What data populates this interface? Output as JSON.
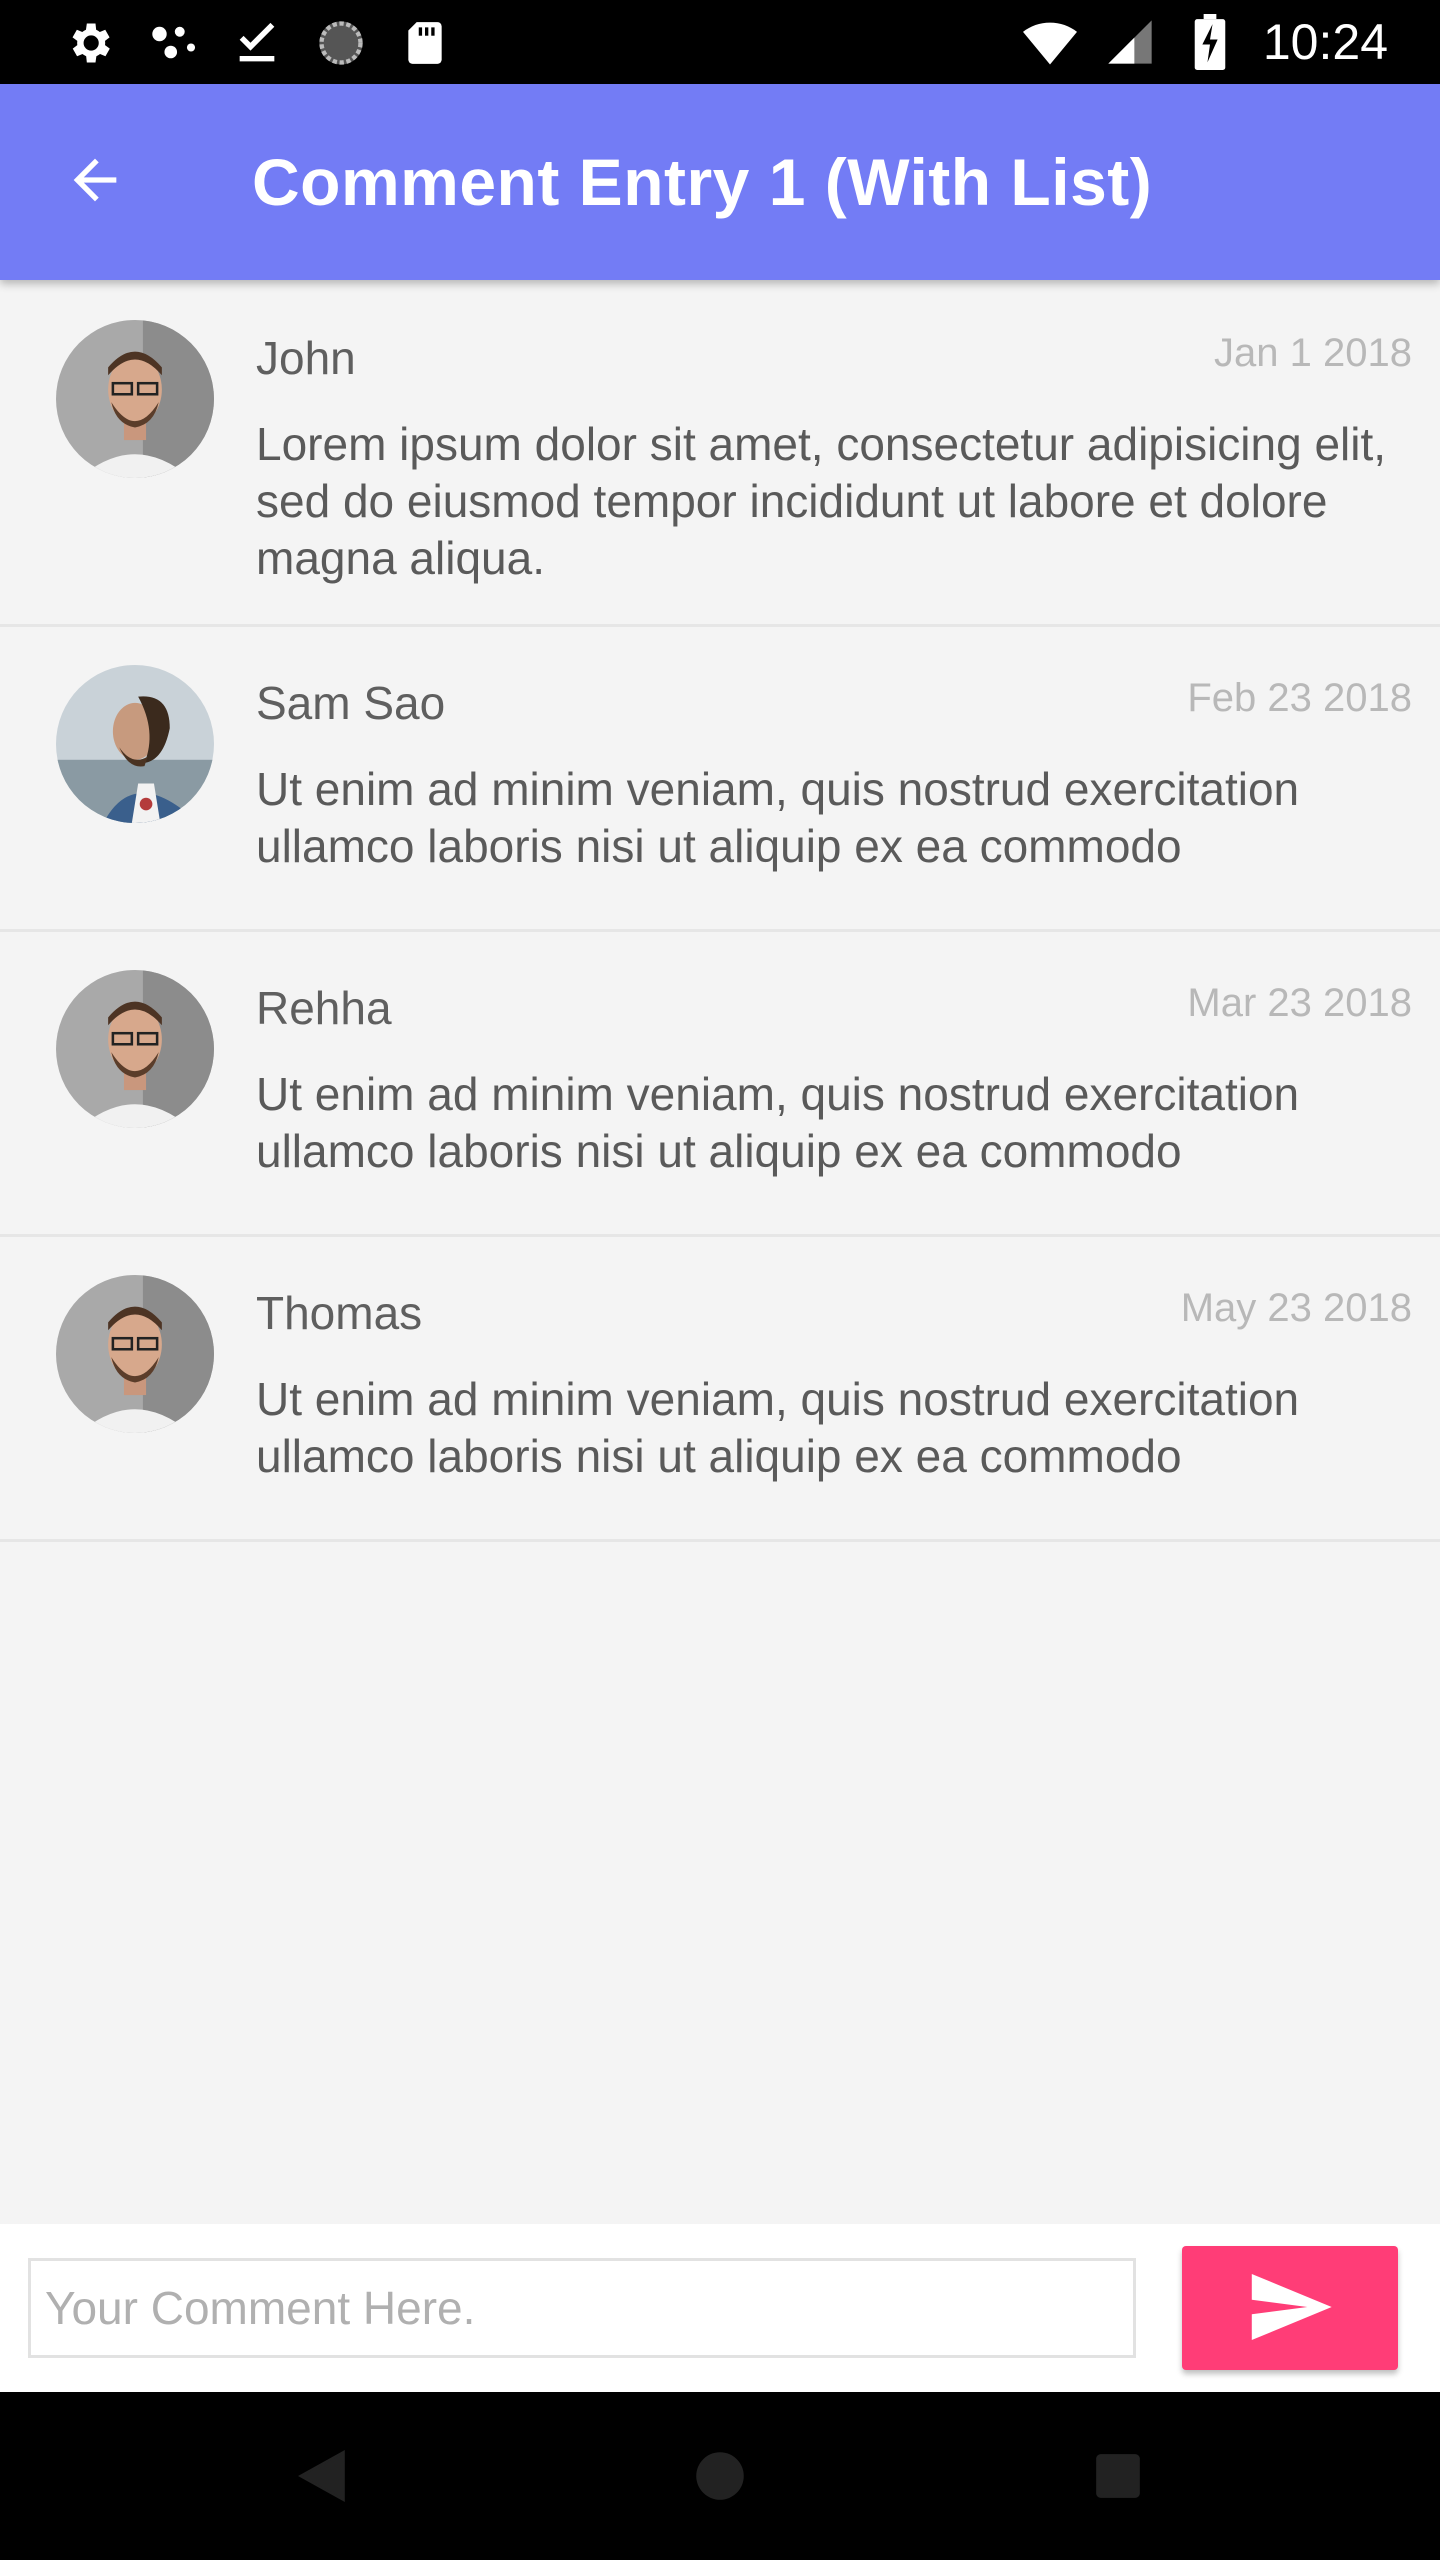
{
  "status_bar": {
    "time": "10:24",
    "icons": [
      "gear-icon",
      "dots-icon",
      "download-done-icon",
      "spinner-icon",
      "sd-card-icon",
      "wifi-icon",
      "signal-icon",
      "battery-charging-icon"
    ]
  },
  "app_bar": {
    "title": "Comment Entry 1 (With List)",
    "back_icon": "arrow-back-icon",
    "color": "#737cf5"
  },
  "comments": [
    {
      "name": "John",
      "date": "Jan 1 2018",
      "text": "Lorem ipsum dolor sit amet, consectetur adipisicing elit, sed do eiusmod tempor incididunt ut labore et dolore magna aliqua.",
      "avatar": "avatar-glasses"
    },
    {
      "name": "Sam Sao",
      "date": "Feb 23 2018",
      "text": "Ut enim ad minim veniam, quis nostrud exercitation ullamco laboris nisi ut aliquip ex ea commodo",
      "avatar": "avatar-profile"
    },
    {
      "name": "Rehha",
      "date": "Mar 23 2018",
      "text": "Ut enim ad minim veniam, quis nostrud exercitation ullamco laboris nisi ut aliquip ex ea commodo",
      "avatar": "avatar-glasses"
    },
    {
      "name": "Thomas",
      "date": "May 23 2018",
      "text": "Ut enim ad minim veniam, quis nostrud exercitation ullamco laboris nisi ut aliquip ex ea commodo",
      "avatar": "avatar-glasses"
    }
  ],
  "composer": {
    "placeholder": "Your Comment Here.",
    "value": "",
    "send_icon": "send-icon",
    "send_color": "#ff3d77"
  },
  "nav_bar": {
    "icons": [
      "back-triangle-icon",
      "home-circle-icon",
      "recents-square-icon"
    ]
  }
}
